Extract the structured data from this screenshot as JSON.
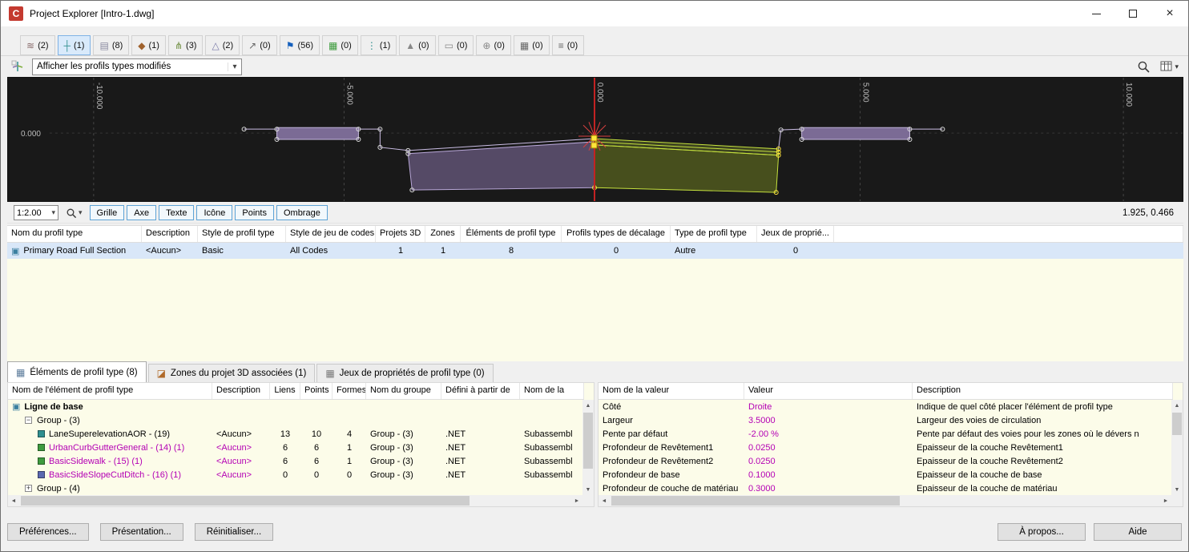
{
  "window": {
    "title": "Project Explorer [Intro-1.dwg]",
    "app_initial": "C"
  },
  "icons": {
    "chevron_down": "▾",
    "close": "×",
    "scroll_up": "▲",
    "scroll_down": "▼",
    "scroll_left": "◄",
    "scroll_right": "►"
  },
  "colors": {
    "magenta": "#b400b4",
    "selection_blue": "#d9e7f8",
    "panel_yellow": "#fcfce9",
    "canvas_bg": "#191919",
    "outline_purple": "#cabde4",
    "fill_purple": "#7b6b95",
    "highlight_green": "#c6e23e",
    "node_yellow": "#ffe43c",
    "centerline_red": "#c42222",
    "active_tab_blue": "#d9eafb"
  },
  "object_tabs": [
    {
      "name": "alignments",
      "glyph": "≋",
      "color": "#8a6d6d",
      "count": "(2)",
      "active": false
    },
    {
      "name": "assemblies",
      "glyph": "┼",
      "color": "#2f8f8f",
      "count": "(1)",
      "active": true
    },
    {
      "name": "corridors",
      "glyph": "▤",
      "color": "#8a8aa0",
      "count": "(8)",
      "active": false
    },
    {
      "name": "intersections",
      "glyph": "◆",
      "color": "#a0622d",
      "count": "(1)",
      "active": false
    },
    {
      "name": "pipe-networks",
      "glyph": "⋔",
      "color": "#6a8a3a",
      "count": "(3)",
      "active": false
    },
    {
      "name": "pressure-networks",
      "glyph": "△",
      "color": "#7a7aa8",
      "count": "(2)",
      "active": false
    },
    {
      "name": "profiles",
      "glyph": "↗",
      "color": "#666666",
      "count": "(0)",
      "active": false
    },
    {
      "name": "points",
      "glyph": "⚑",
      "color": "#1560bd",
      "count": "(56)",
      "active": false
    },
    {
      "name": "point-groups",
      "glyph": "▦",
      "color": "#3a9a3a",
      "count": "(0)",
      "active": false
    },
    {
      "name": "sample-lines",
      "glyph": "⋮",
      "color": "#2f8f8f",
      "count": "(1)",
      "active": false
    },
    {
      "name": "surfaces",
      "glyph": "▲",
      "color": "#888888",
      "count": "(0)",
      "active": false
    },
    {
      "name": "parcels",
      "glyph": "▭",
      "color": "#888888",
      "count": "(0)",
      "active": false
    },
    {
      "name": "survey",
      "glyph": "⊕",
      "color": "#888888",
      "count": "(0)",
      "active": false
    },
    {
      "name": "tables",
      "glyph": "▦",
      "color": "#666666",
      "count": "(0)",
      "active": false
    },
    {
      "name": "property-sets",
      "glyph": "≡",
      "color": "#666666",
      "count": "(0)",
      "active": false
    }
  ],
  "filter_bar": {
    "dropdown_value": "Afficher les profils types modifiés"
  },
  "viewport": {
    "ruler_labels": [
      "-10.000",
      "-5.000",
      "0.000",
      "5.000",
      "10.000"
    ],
    "elevation_label": "0.000",
    "scale_value": "1:2.00",
    "toggle_buttons": [
      {
        "name": "grid-toggle",
        "label": "Grille"
      },
      {
        "name": "axis-toggle",
        "label": "Axe"
      },
      {
        "name": "text-toggle",
        "label": "Texte"
      },
      {
        "name": "icon-toggle",
        "label": "Icône"
      },
      {
        "name": "points-toggle",
        "label": "Points"
      },
      {
        "name": "shading-toggle",
        "label": "Ombrage"
      }
    ],
    "coordinates": "1.925, 0.466"
  },
  "assembly_table": {
    "columns": [
      "Nom du profil type",
      "Description",
      "Style de profil type",
      "Style de jeu de codes",
      "Projets 3D",
      "Zones",
      "Éléments de profil type",
      "Profils types de décalage",
      "Type de profil type",
      "Jeux de proprié..."
    ],
    "row": {
      "icon_glyph": "▣",
      "icon_color": "#3a7f9f",
      "values": [
        "Primary Road Full Section",
        "<Aucun>",
        "Basic",
        "All Codes",
        "1",
        "1",
        "8",
        "0",
        "Autre",
        "0"
      ]
    }
  },
  "detail_tabs": [
    {
      "name": "tab-elements",
      "glyph": "▦",
      "color": "#5a7a9a",
      "label": "Éléments de profil type (8)",
      "active": true
    },
    {
      "name": "tab-zones",
      "glyph": "◪",
      "color": "#b06a2a",
      "label": "Zones du projet 3D associées (1)",
      "active": false
    },
    {
      "name": "tab-property-sets",
      "glyph": "▦",
      "color": "#777777",
      "label": "Jeux de propriétés de profil type (0)",
      "active": false
    }
  ],
  "elements_table": {
    "columns": [
      "Nom de l'élément de profil type",
      "Description",
      "Liens",
      "Points",
      "Formes",
      "Nom du groupe",
      "Défini à partir de",
      "Nom de la"
    ],
    "rows": [
      {
        "indent": 0,
        "glyph": "▣",
        "glyph_color": "#3a7f9f",
        "name": "Ligne de base",
        "bold": true,
        "desc": "",
        "liens": "",
        "points": "",
        "formes": "",
        "groupe": "",
        "defini": "",
        "nom": ""
      },
      {
        "indent": 1,
        "expander": "minus",
        "name": "Group - (3)",
        "desc": "",
        "liens": "",
        "points": "",
        "formes": "",
        "groupe": "",
        "defini": "",
        "nom": ""
      },
      {
        "indent": 2,
        "swatch": "#2f8f8f",
        "name": "LaneSuperelevationAOR - (19)",
        "magenta": false,
        "desc": "<Aucun>",
        "liens": "13",
        "points": "10",
        "formes": "4",
        "groupe": "Group - (3)",
        "defini": ".NET",
        "nom": "Subassembl"
      },
      {
        "indent": 2,
        "swatch": "#3f9b3f",
        "name": "UrbanCurbGutterGeneral - (14) (1)",
        "magenta": true,
        "desc": "<Aucun>",
        "liens": "6",
        "points": "6",
        "formes": "1",
        "groupe": "Group - (3)",
        "defini": ".NET",
        "nom": "Subassembl"
      },
      {
        "indent": 2,
        "swatch": "#3f9b3f",
        "name": "BasicSidewalk - (15) (1)",
        "magenta": true,
        "desc": "<Aucun>",
        "liens": "6",
        "points": "6",
        "formes": "1",
        "groupe": "Group - (3)",
        "defini": ".NET",
        "nom": "Subassembl"
      },
      {
        "indent": 2,
        "swatch": "#5a68b0",
        "name": "BasicSideSlopeCutDitch - (16) (1)",
        "magenta": true,
        "desc": "<Aucun>",
        "liens": "0",
        "points": "0",
        "formes": "0",
        "groupe": "Group - (3)",
        "defini": ".NET",
        "nom": "Subassembl"
      },
      {
        "indent": 1,
        "expander": "plus",
        "name": "Group - (4)",
        "desc": "",
        "liens": "",
        "points": "",
        "formes": "",
        "groupe": "",
        "defini": "",
        "nom": ""
      }
    ]
  },
  "values_table": {
    "columns": [
      "Nom de la valeur",
      "Valeur",
      "Description"
    ],
    "rows": [
      {
        "name": "Côté",
        "value": "Droite",
        "desc": "Indique de quel côté placer l'élément de profil type"
      },
      {
        "name": "Largeur",
        "value": "3.5000",
        "desc": "Largeur des voies de circulation"
      },
      {
        "name": "Pente par défaut",
        "value": "-2.00 %",
        "desc": "Pente par défaut des voies pour les zones où le dévers n"
      },
      {
        "name": "Profondeur de Revêtement1",
        "value": "0.0250",
        "desc": "Epaisseur de la couche Revêtement1"
      },
      {
        "name": "Profondeur de Revêtement2",
        "value": "0.0250",
        "desc": "Epaisseur de la couche Revêtement2"
      },
      {
        "name": "Profondeur de base",
        "value": "0.1000",
        "desc": "Epaisseur de la couche de base"
      },
      {
        "name": "Profondeur de couche de matériau",
        "value": "0.3000",
        "desc": "Epaisseur de la couche de matériau"
      }
    ]
  },
  "footer": {
    "left": [
      {
        "name": "preferences-button",
        "label": "Préférences..."
      },
      {
        "name": "presentation-button",
        "label": "Présentation..."
      },
      {
        "name": "reset-button",
        "label": "Réinitialiser..."
      }
    ],
    "right": [
      {
        "name": "about-button",
        "label": "À propos..."
      },
      {
        "name": "help-button",
        "label": "Aide"
      }
    ]
  }
}
